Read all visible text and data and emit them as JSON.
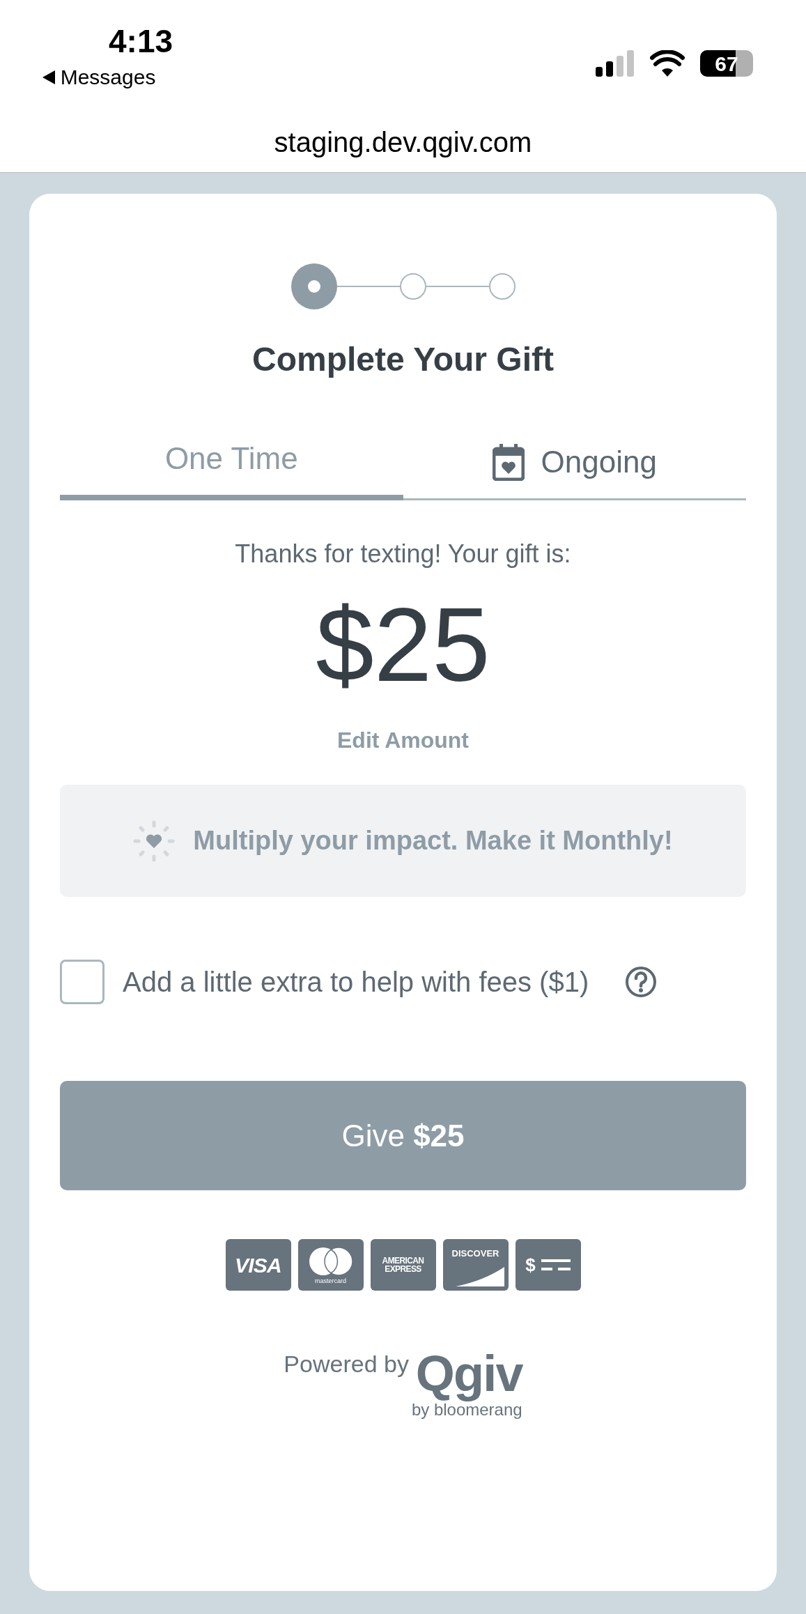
{
  "status_bar": {
    "time": "4:13",
    "back_label": "Messages",
    "battery": "67"
  },
  "address_bar": {
    "url": "staging.dev.qgiv.com"
  },
  "stepper": [
    {
      "current": true
    },
    {
      "current": false
    },
    {
      "current": false
    }
  ],
  "title": "Complete Your Gift",
  "tabs": [
    {
      "label": "One Time",
      "selected": true,
      "kind": "plain"
    },
    {
      "label": "Ongoing",
      "selected": false,
      "kind": "calendar"
    }
  ],
  "amount_intro": "Thanks for texting! Your gift is:",
  "amount": "$25",
  "edit_link": "Edit Amount",
  "promo": "Multiply your impact. Make it Monthly!",
  "fee_option": {
    "label": "Add a little extra to help with fees ($1)",
    "checked": false
  },
  "give_button": "Give **$25**",
  "payment_methods": [
    {
      "kind": "visa",
      "lines": [
        "VISA"
      ]
    },
    {
      "kind": "mastercard",
      "lines": [
        "mastercard"
      ]
    },
    {
      "kind": "amex",
      "lines": [
        "AMERICAN",
        "EXPRESS"
      ]
    },
    {
      "kind": "discover",
      "lines": [
        "DISCOVER"
      ]
    },
    {
      "kind": "check",
      "lines": [
        "$"
      ]
    }
  ],
  "footer": {
    "powered_by": "Powered by",
    "brand": "Qgiv",
    "brand_sub": "by bloomerang"
  }
}
